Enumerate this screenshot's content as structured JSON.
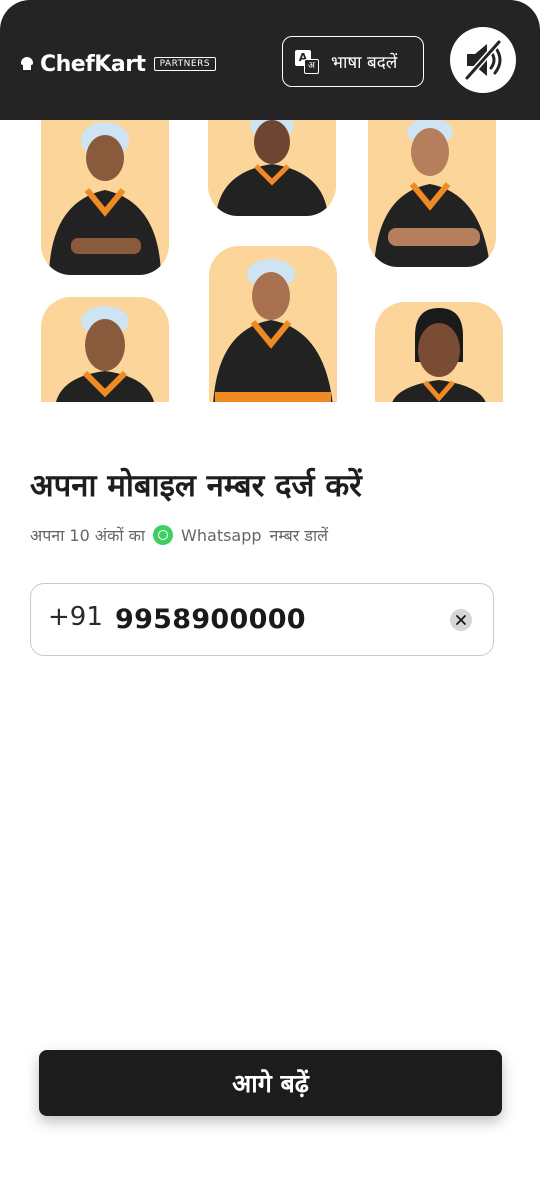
{
  "header": {
    "brand": "ChefKart",
    "badge": "PARTNERS",
    "language_button": "भाषा बदलें",
    "translate_icon": "translate-icon",
    "sound_icon": "volume-off-icon",
    "background": "#242424"
  },
  "gallery": {
    "background": "#fbd59a",
    "photos": [
      {
        "name": "chef-photo-1",
        "uniform": "#222222",
        "accent": "#f08a24",
        "skin": "#8a5a3c",
        "cap": true
      },
      {
        "name": "chef-photo-2",
        "uniform": "#222222",
        "accent": "#f08a24",
        "skin": "#6e4530",
        "cap": true
      },
      {
        "name": "chef-photo-3",
        "uniform": "#222222",
        "accent": "#f08a24",
        "skin": "#b57e5c",
        "cap": true
      },
      {
        "name": "chef-photo-4",
        "uniform": "#222222",
        "accent": "#f08a24",
        "skin": "#8a5a3c",
        "cap": true
      },
      {
        "name": "chef-photo-5",
        "uniform": "#222222",
        "accent": "#f08a24",
        "skin": "#a8714f",
        "cap": true
      },
      {
        "name": "chef-photo-6",
        "uniform": "#222222",
        "accent": "#f08a24",
        "skin": "#7a4c34",
        "cap": false
      }
    ]
  },
  "form": {
    "title": "अपना मोबाइल नम्बर दर्ज करें",
    "subtitle_prefix": "अपना 10 अंकों का",
    "subtitle_brand": "Whatsapp",
    "subtitle_suffix": "नम्बर डालें",
    "whatsapp_icon": "whatsapp-icon",
    "country_code": "+91",
    "phone_number": "9958900000",
    "clear_icon": "close-icon"
  },
  "footer": {
    "continue_label": "आगे बढ़ें"
  },
  "colors": {
    "accent": "#f08a24",
    "whatsapp_green": "#3ecf5e",
    "button": "#1c1c1c"
  }
}
